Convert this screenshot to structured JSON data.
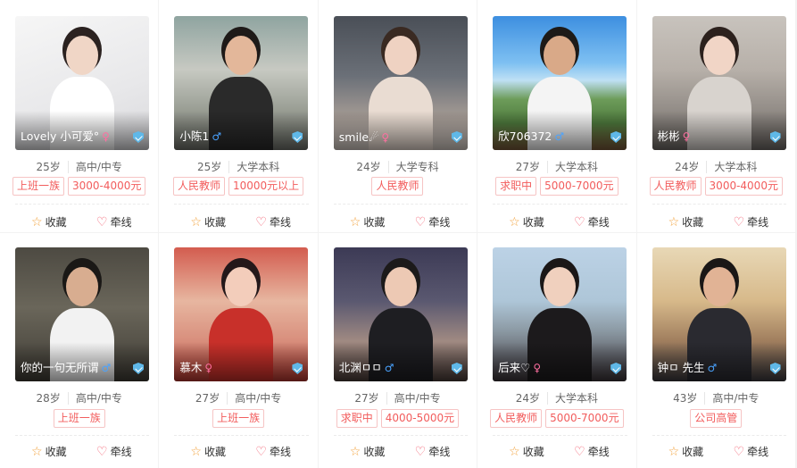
{
  "actions": {
    "fav_label": "收藏",
    "pull_label": "牵线",
    "fav_icon": "star-outline-icon",
    "pull_icon": "heart-outline-icon"
  },
  "colors": {
    "tag_text": "#f25c5c",
    "male": "#4aa3ff",
    "female": "#ff6fa0",
    "verify": "#5fb8e8"
  },
  "profiles": [
    {
      "name": "Lovely 小可爱°",
      "gender": "female",
      "gender_icon": "female-icon",
      "age": "25岁",
      "education": "高中/中专",
      "tags": [
        "上班一族",
        "3000-4000元"
      ]
    },
    {
      "name": "小陈1",
      "gender": "male",
      "gender_icon": "male-icon",
      "age": "25岁",
      "education": "大学本科",
      "tags": [
        "人民教师",
        "10000元以上"
      ]
    },
    {
      "name": "smile☄",
      "gender": "female",
      "gender_icon": "female-icon",
      "age": "24岁",
      "education": "大学专科",
      "tags": [
        "人民教师"
      ]
    },
    {
      "name": "欣706372",
      "gender": "male",
      "gender_icon": "male-icon",
      "age": "27岁",
      "education": "大学本科",
      "tags": [
        "求职中",
        "5000-7000元"
      ]
    },
    {
      "name": "彬彬",
      "gender": "female",
      "gender_icon": "female-icon",
      "age": "24岁",
      "education": "大学本科",
      "tags": [
        "人民教师",
        "3000-4000元"
      ]
    },
    {
      "name": "你的一句无所谓",
      "gender": "male",
      "gender_icon": "male-icon",
      "age": "28岁",
      "education": "高中/中专",
      "tags": [
        "上班一族"
      ]
    },
    {
      "name": "慕木",
      "gender": "female",
      "gender_icon": "female-icon",
      "age": "27岁",
      "education": "高中/中专",
      "tags": [
        "上班一族"
      ]
    },
    {
      "name": "北渊ㅁㅁ",
      "gender": "male",
      "gender_icon": "male-icon",
      "age": "27岁",
      "education": "高中/中专",
      "tags": [
        "求职中",
        "4000-5000元"
      ]
    },
    {
      "name": "后来♡",
      "gender": "female",
      "gender_icon": "female-icon",
      "age": "24岁",
      "education": "大学本科",
      "tags": [
        "人民教师",
        "5000-7000元"
      ]
    },
    {
      "name": "钟ㅁ 先生",
      "gender": "male",
      "gender_icon": "male-icon",
      "age": "43岁",
      "education": "高中/中专",
      "tags": [
        "公司高管"
      ]
    }
  ]
}
